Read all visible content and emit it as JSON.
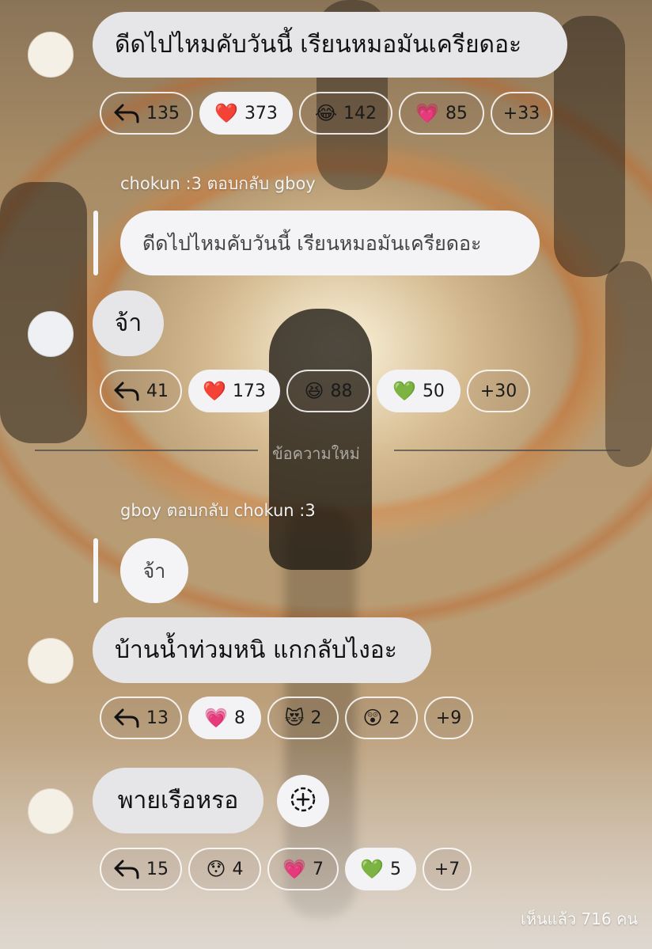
{
  "messages": [
    {
      "text": "ดีดไปไหมคับวันนี้ เรียนหมอมันเครียดอะ",
      "reactions": [
        {
          "icon": "reply-arrow-icon",
          "count": "135"
        },
        {
          "emoji": "❤️",
          "count": "373",
          "selected": true
        },
        {
          "emoji": "😂",
          "count": "142"
        },
        {
          "emoji": "💗",
          "count": "85"
        },
        {
          "count": "+33"
        }
      ]
    },
    {
      "reply_header": "chokun :3 ตอบกลับ gboy",
      "quoted_text": "ดีดไปไหมคับวันนี้ เรียนหมอมันเครียดอะ",
      "text": "จ้า",
      "reactions": [
        {
          "icon": "reply-arrow-icon",
          "count": "41"
        },
        {
          "emoji": "❤️",
          "count": "173",
          "selected": true
        },
        {
          "emoji": "😆",
          "count": "88"
        },
        {
          "emoji": "💚",
          "count": "50"
        },
        {
          "count": "+30"
        }
      ]
    },
    {
      "reply_header": "gboy ตอบกลับ chokun :3",
      "quoted_text": "จ้า",
      "text": "บ้านน้ำท่วมหนิ แกกลับไงอะ",
      "reactions": [
        {
          "icon": "reply-arrow-icon",
          "count": "13"
        },
        {
          "emoji": "💗",
          "count": "8",
          "selected": true
        },
        {
          "emoji": "😻",
          "count": "2"
        },
        {
          "emoji": "😲",
          "count": "2"
        },
        {
          "count": "+9"
        }
      ]
    },
    {
      "text": "พายเรือหรอ",
      "reactions": [
        {
          "icon": "reply-arrow-icon",
          "count": "15"
        },
        {
          "emoji": "😯",
          "count": "4"
        },
        {
          "emoji": "💗",
          "count": "7"
        },
        {
          "emoji": "💚",
          "count": "5",
          "selected": true
        },
        {
          "count": "+7"
        }
      ]
    }
  ],
  "divider": {
    "label": "ข้อความใหม่"
  },
  "footer": {
    "viewers": "เห็นแล้ว 716 คน"
  },
  "icons": {
    "add_reaction": "add-reaction-icon"
  },
  "colors": {
    "bubble": "#e6e6e8",
    "selected_chip": "#f3f3f5",
    "chip_border": "#ffffff"
  }
}
